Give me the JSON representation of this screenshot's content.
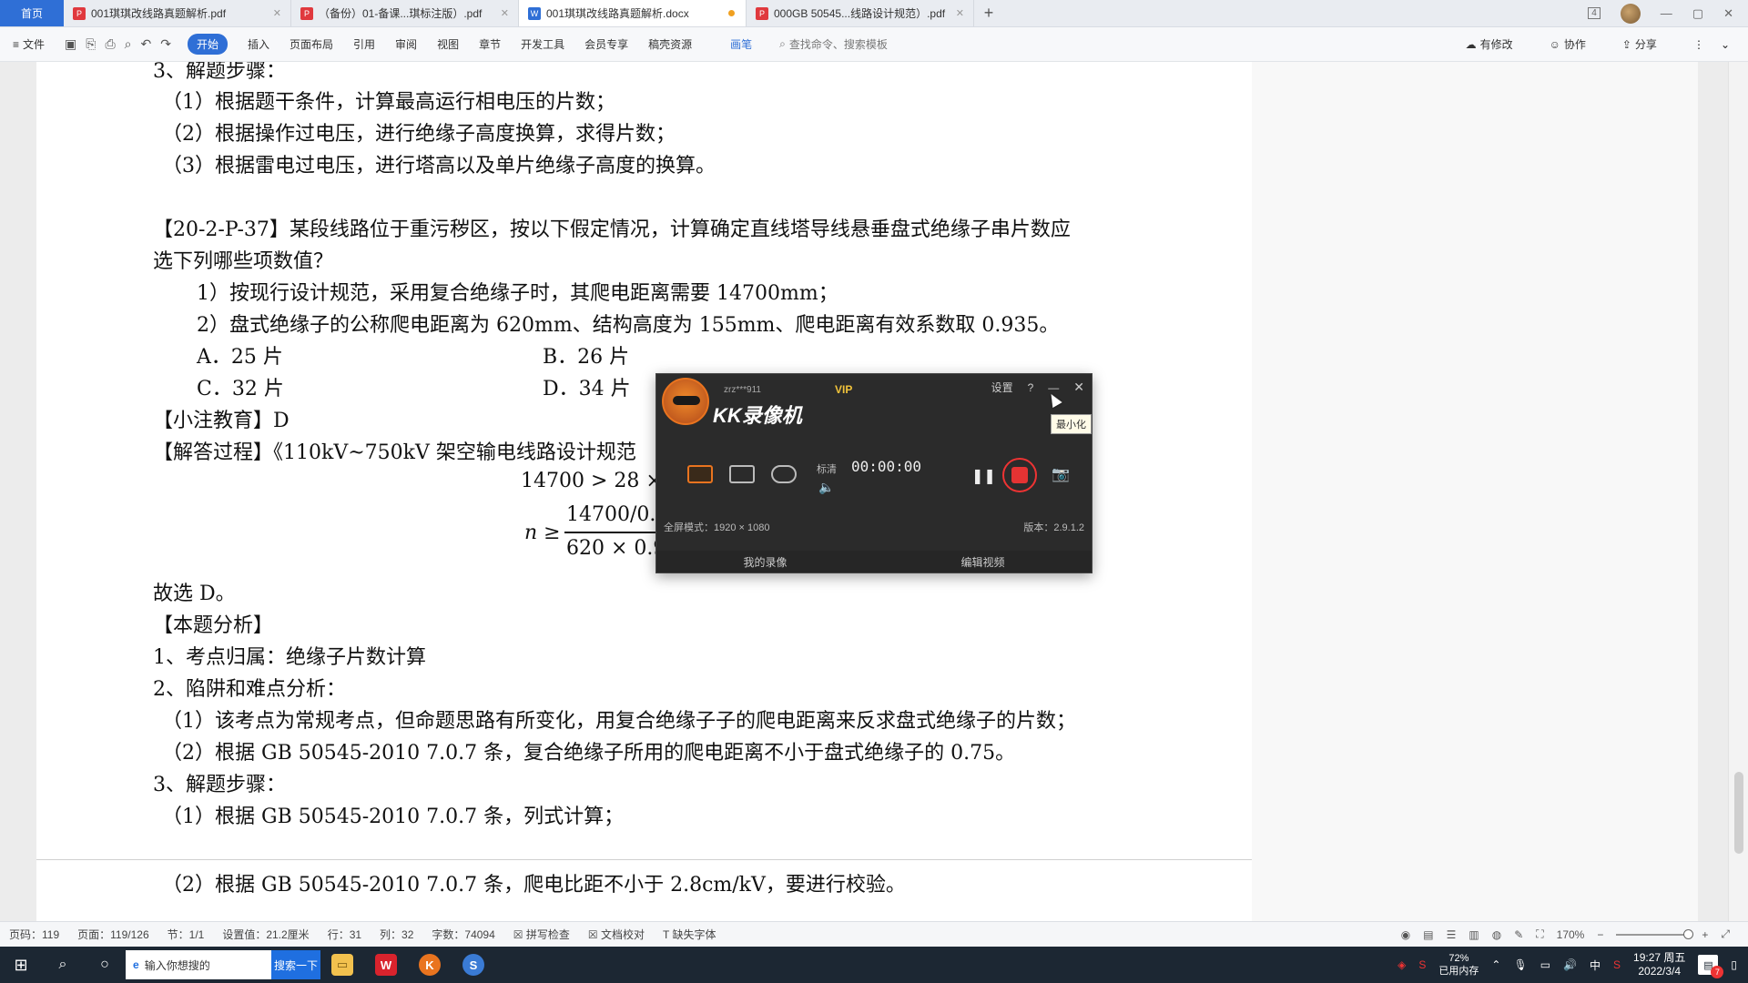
{
  "tabs": {
    "home": "首页",
    "items": [
      {
        "label": "001琪琪改线路真题解析.pdf",
        "type": "pdf"
      },
      {
        "label": "（备份）01-备课...琪标注版）.pdf",
        "type": "pdf"
      },
      {
        "label": "001琪琪改线路真题解析.docx",
        "type": "doc"
      },
      {
        "label": "000GB 50545...线路设计规范）.pdf",
        "type": "pdf"
      }
    ],
    "add": "+",
    "page_count_badge": "4"
  },
  "toolbar": {
    "file": "文件",
    "start": "开始",
    "insert": "插入",
    "layout": "页面布局",
    "ref": "引用",
    "review": "审阅",
    "view": "视图",
    "chapter": "章节",
    "devtools": "开发工具",
    "member": "会员专享",
    "resources": "稿壳资源",
    "pen": "画笔",
    "search": "查找命令、搜索模板",
    "modified": "有修改",
    "collab": "协作",
    "share": "分享"
  },
  "document": {
    "lines": [
      "3、解题步骤：",
      "（1）根据题干条件，计算最高运行相电压的片数；",
      "（2）根据操作过电压，进行绝缘子高度换算，求得片数；",
      "（3）根据雷电过电压，进行塔高以及单片绝缘子高度的换算。",
      "【20-2-P-37】某段线路位于重污秽区，按以下假定情况，计算确定直线塔导线悬垂盘式绝缘子串片数应",
      "选下列哪些项数值？",
      "1）按现行设计规范，采用复合绝缘子时，其爬电距离需要 14700mm；",
      "2）盘式绝缘子的公称爬电距离为 620mm、结构高度为 155mm、爬电距离有效系数取 0.935。",
      "A．25 片",
      "B．26 片",
      "C．32 片",
      "D．34 片",
      "【小注教育】D",
      "【解答过程】《110kV~750kV  架空输电线路设计规范",
      "14700 > 28 ×",
      "n ≥",
      "14700/0.",
      "620 × 0.9",
      "故选 D。",
      "【本题分析】",
      "1、考点归属：绝缘子片数计算",
      "2、陷阱和难点分析：",
      "（1）该考点为常规考点，但命题思路有所变化，用复合绝缘子子的爬电距离来反求盘式绝缘子的片数；",
      "（2）根据 GB 50545-2010 7.0.7 条，复合绝缘子所用的爬电距离不小于盘式绝缘子的 0.75。",
      "3、解题步骤：",
      "（1）根据 GB 50545-2010 7.0.7 条，列式计算；",
      "（2）根据 GB 50545-2010 7.0.7 条，爬电比距不小于 2.8cm/kV，要进行校验。"
    ]
  },
  "kk": {
    "user": "zrz***911",
    "vip": "VIP",
    "title": "KK录像机",
    "settings": "设置",
    "help": "?",
    "minimize": "—",
    "close": "✕",
    "quality": "标清",
    "timer": "00:00:00",
    "fullscreen_mode": "全屏模式：1920 × 1080",
    "version": "版本：2.9.1.2",
    "my_recordings": "我的录像",
    "edit_video": "编辑视频",
    "tooltip": "最小化"
  },
  "statusbar": {
    "page_no": "页码：119",
    "pages": "页面：119/126",
    "section": "节：1/1",
    "setting": "设置值：21.2厘米",
    "row": "行：31",
    "col": "列：32",
    "words": "字数：74094",
    "spell": "拼写检查",
    "proof": "文档校对",
    "missing_font": "缺失字体",
    "zoom": "170%"
  },
  "taskbar": {
    "search_placeholder": "输入你想搜的",
    "search_btn": "搜索一下",
    "memory_pct": "72%",
    "memory_label": "已用内存",
    "time": "19:27 周五",
    "date": "2022/3/4",
    "notif_count": "7"
  }
}
